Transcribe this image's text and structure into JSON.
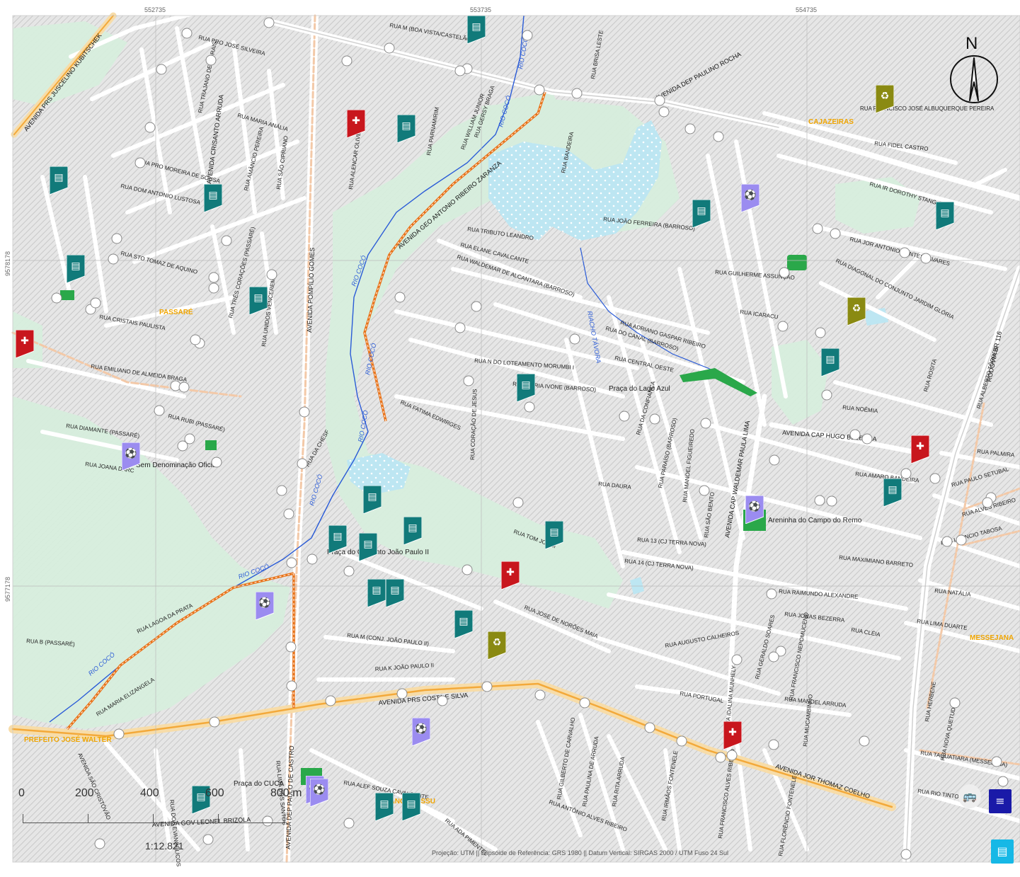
{
  "coords": {
    "x_labels": [
      "552735",
      "553735",
      "554735"
    ],
    "y_labels": [
      "9578178",
      "9577178"
    ]
  },
  "neighborhoods": [
    "PASSARÉ",
    "CAJAZEIRAS",
    "MESSEJANA",
    "JANGURUSSU",
    "PREFEITO JOSÉ WALTER"
  ],
  "rivers": [
    "RIO COCÓ",
    "RIACHO TÁVORA"
  ],
  "places": [
    "Praça do Lago Azul",
    "Sem Denominação Oficial",
    "Areninha do Campo do Remo",
    "Praça do Conjunto João Paulo II",
    "Praça do CUCA"
  ],
  "major_roads": [
    "AVENIDA PRS JUSCELINO KUBITSCHEK",
    "AVENIDA POMPÍLIO GOMES",
    "AVENIDA CRISANTO ARRUDA",
    "AVENIDA DEP PAULINO ROCHA",
    "AVENIDA GEO ANTONIO RIBEIRO ZARANZA",
    "AVENIDA PRS COSTA E SILVA",
    "AVENIDA JOR THOMAZ COELHO",
    "AVENIDA CAP HUGO BEZERRA",
    "AVENIDA CAP WALDEMAR PAULA LIMA",
    "RODOVIA BR 116",
    "AVENIDA GOV LEONEL BRIZOLA",
    "AVENIDA DEP PAULO DE CASTRO"
  ],
  "streets": [
    "RUA PRO JOSÉ SILVEIRA",
    "RUA M (BOA VISTA/CASTELÃO)",
    "RUA TRAJANO DE MORAIS",
    "RUA MARIA ANÁLIA",
    "RUA AMÂNCIO PEREIRA",
    "RUA SÃO CIPRIANO",
    "RUA PRO MOREIRA DE SOUSA",
    "RUA DOM ANTONIO LUSTOSA",
    "RUA STO TOMAZ DE AQUINO",
    "RUA TRÊS CORAÇÕES (PASSARÉ)",
    "RUA UNIDOS VENCEREMOS",
    "RUA CRISTAIS PAULISTA",
    "RUA EMILIANO DE ALMEIDA BRAGA",
    "RUA DIAMANTE (PASSARÉ)",
    "RUA JOANA DARC",
    "RUA RUBI (PASSARÉ)",
    "RUA DA CHESF",
    "RUA LAGOA DA PRATA",
    "RUA B (PASSARÉ)",
    "RUA MARIA ELIZANGELA",
    "RUA ALENCAR OLIVEIRA",
    "RUA PARNAMIRIM",
    "RUA WILLIAM JUNIOR",
    "RUA GERSY BRAGA",
    "RUA BRISA LESTE",
    "RUA BANDEIRA",
    "RUA TRIBUTO LEANDRO",
    "RUA ELANE CAVALCANTE",
    "RUA WALDEMAR DE ALCANTARA (BARROSO)",
    "RUA JOÃO FERREIRA (BARROSO)",
    "RUA GUILHERME ASSUNÇÃO",
    "RUA ICARACU",
    "RUA ADRIANO GASPAR RIBEIRO",
    "RUA DO CANAL (BARROSO)",
    "RUA CENTRAL OESTE",
    "RUA N DO LOTEAMENTO MORUMBI I",
    "RUA MARIA IVONE (BARROSO)",
    "RUA FATIMA EDWIRGES",
    "RUA CORAÇÃO DE JESUS",
    "RUA DA CONFIANÇA",
    "RUA PARAÍSO (BARROSO)",
    "RUA MANOEL FIGUEIREDO",
    "RUA SÃO BENTO",
    "RUA DAURA",
    "RUA 13 (CJ TERRA NOVA)",
    "RUA 14 (CJ TERRA NOVA)",
    "RUA TOM JOBIM",
    "RUA JOSÉ DE NORÕES MAIA",
    "RUA M (CONJ. JOÃO PAULO II)",
    "RUA K JOÃO PAULO II",
    "RUA AUGUSTO CALHEIROS",
    "RUA PORTUGAL",
    "RUA GERALDO SOARES",
    "RUA RAIMUNDO ALEXANDRE",
    "RUA JONAS BEZERRA",
    "RUA MANOEL ARRUDA",
    "RUA MUCAMBINHO",
    "RUA MAXIMIANO BARRETO",
    "RUA AMARO BANDEIRA",
    "RUA NOÊMIA",
    "RUA FIDEL CASTRO",
    "RUA IR DOROTHY STANG",
    "RUA FRANCISCO JOSÉ ALBUQUERQUE PEREIRA",
    "RUA JOR ANTONIO PONTES TAVARES",
    "RUA DIAGONAL DO CONJUNTO JARDIM GLÓRIA",
    "RUA ROSITA",
    "RUA ALBERTO TÔRRES",
    "RUA PALMIRA",
    "RUA PAULO SETUBAL",
    "RUA ALVES RIBEIRO",
    "RUA LEÔNCIO TABOSA",
    "RUA NATÁLIA",
    "RUA LIMA DUARTE",
    "RUA HERBENE",
    "RUA NOVA QUETUDE",
    "RUA TAQUATIARA (MESSEJANA)",
    "RUA RIO TINTO",
    "RUA ALEF SOUZA CAVALCANTE",
    "RUA ADA PIMENTEL",
    "RUA GILBERTO DE CARVALHO",
    "RUA PAULINA DE ARRUDA",
    "RUA RITA ARRUDA",
    "RUA IRMÃOS FONTENELE",
    "RUA ANTÔNIO ALVES RIBEIRO",
    "RUA FLORÊNCIO FONTENELE",
    "RUA FRANCISCO ALVES RIBEIRO",
    "RUA IDALINA MUNHELY",
    "RUA CLÉIA",
    "RUA FRANCISCO NEPOMUCENO",
    "RUA DOS EVANGÉLICOS",
    "RUA LIMA DOS SANTOS",
    "AVENIDA SÃO CRISTÓVÃO"
  ],
  "scale": {
    "labels": [
      "0",
      "200",
      "400",
      "600",
      "800 m"
    ],
    "ratio": "1:12.821"
  },
  "credits": "Projeção: UTM || Elipsóide de Referência:  GRS 1980 || Datum Vertical: SIRGAS 2000 / UTM Fuso 24 Sul",
  "north_label": "N",
  "colors": {
    "health": "#c8161d",
    "library": "#117a7a",
    "sport": "#9b8cf0",
    "waste": "#8a8a12",
    "river": "#2a5bd7",
    "park": "#d7eedd",
    "lake": "#bde6f2",
    "bike_route": "#e8731a"
  }
}
